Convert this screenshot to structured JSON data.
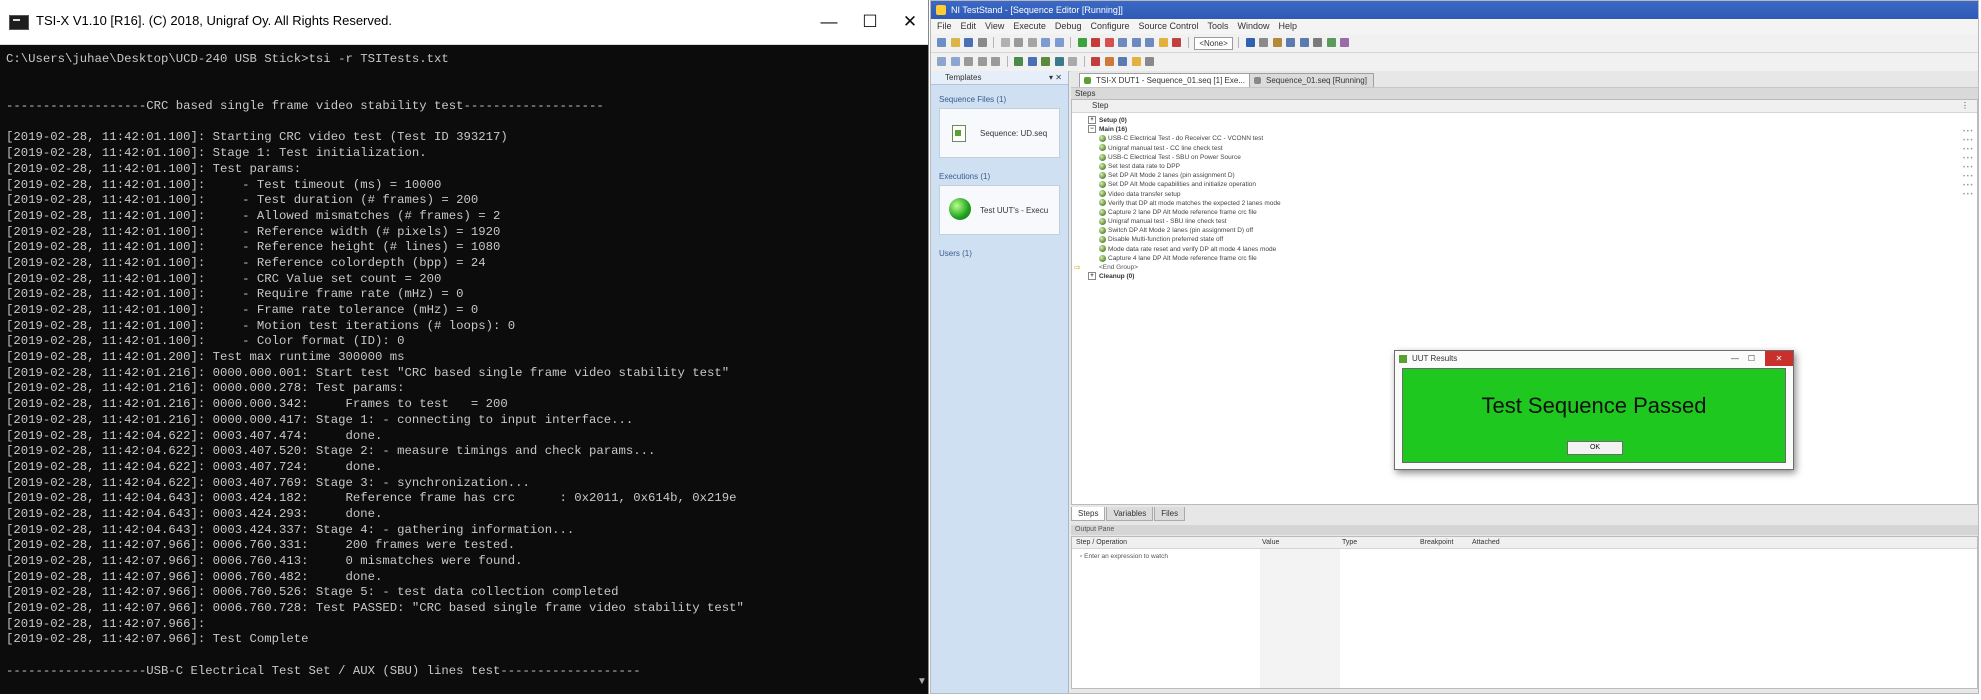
{
  "console": {
    "title": "TSI-X V1.10 [R16]. (C) 2018, Unigraf Oy. All Rights Reserved.",
    "controls": {
      "minimize": "—",
      "maximize": "☐",
      "close": "✕"
    },
    "lines": [
      "C:\\Users\\juhae\\Desktop\\UCD-240 USB Stick>tsi -r TSITests.txt",
      "",
      "",
      "-------------------CRC based single frame video stability test-------------------",
      "",
      "[2019-02-28, 11:42:01.100]: Starting CRC video test (Test ID 393217)",
      "[2019-02-28, 11:42:01.100]: Stage 1: Test initialization.",
      "[2019-02-28, 11:42:01.100]: Test params:",
      "[2019-02-28, 11:42:01.100]:     - Test timeout (ms) = 10000",
      "[2019-02-28, 11:42:01.100]:     - Test duration (# frames) = 200",
      "[2019-02-28, 11:42:01.100]:     - Allowed mismatches (# frames) = 2",
      "[2019-02-28, 11:42:01.100]:     - Reference width (# pixels) = 1920",
      "[2019-02-28, 11:42:01.100]:     - Reference height (# lines) = 1080",
      "[2019-02-28, 11:42:01.100]:     - Reference colordepth (bpp) = 24",
      "[2019-02-28, 11:42:01.100]:     - CRC Value set count = 200",
      "[2019-02-28, 11:42:01.100]:     - Require frame rate (mHz) = 0",
      "[2019-02-28, 11:42:01.100]:     - Frame rate tolerance (mHz) = 0",
      "[2019-02-28, 11:42:01.100]:     - Motion test iterations (# loops): 0",
      "[2019-02-28, 11:42:01.100]:     - Color format (ID): 0",
      "[2019-02-28, 11:42:01.200]: Test max runtime 300000 ms",
      "[2019-02-28, 11:42:01.216]: 0000.000.001: Start test \"CRC based single frame video stability test\"",
      "[2019-02-28, 11:42:01.216]: 0000.000.278: Test params:",
      "[2019-02-28, 11:42:01.216]: 0000.000.342:     Frames to test   = 200",
      "[2019-02-28, 11:42:01.216]: 0000.000.417: Stage 1: - connecting to input interface...",
      "[2019-02-28, 11:42:04.622]: 0003.407.474:     done.",
      "[2019-02-28, 11:42:04.622]: 0003.407.520: Stage 2: - measure timings and check params...",
      "[2019-02-28, 11:42:04.622]: 0003.407.724:     done.",
      "[2019-02-28, 11:42:04.622]: 0003.407.769: Stage 3: - synchronization...",
      "[2019-02-28, 11:42:04.643]: 0003.424.182:     Reference frame has crc      : 0x2011, 0x614b, 0x219e",
      "[2019-02-28, 11:42:04.643]: 0003.424.293:     done.",
      "[2019-02-28, 11:42:04.643]: 0003.424.337: Stage 4: - gathering information...",
      "[2019-02-28, 11:42:07.966]: 0006.760.331:     200 frames were tested.",
      "[2019-02-28, 11:42:07.966]: 0006.760.413:     0 mismatches were found.",
      "[2019-02-28, 11:42:07.966]: 0006.760.482:     done.",
      "[2019-02-28, 11:42:07.966]: 0006.760.526: Stage 5: - test data collection completed",
      "[2019-02-28, 11:42:07.966]: 0006.760.728: Test PASSED: \"CRC based single frame video stability test\"",
      "[2019-02-28, 11:42:07.966]:",
      "[2019-02-28, 11:42:07.966]: Test Complete",
      "",
      "-------------------USB-C Electrical Test Set / AUX (SBU) lines test-------------------"
    ]
  },
  "teststand": {
    "title": "NI TestStand - [Sequence Editor [Running]]",
    "menu": [
      "File",
      "Edit",
      "View",
      "Execute",
      "Debug",
      "Configure",
      "Source Control",
      "Tools",
      "Window",
      "Help"
    ],
    "model_combo": "<None>",
    "left_pane": {
      "header": "Templates",
      "groups": [
        {
          "title": "Sequence Files (1)",
          "item": "Sequence: UD.seq"
        },
        {
          "title": "Executions (1)",
          "item": "Test UUT's - Execu"
        },
        {
          "title": "Users (1)"
        }
      ]
    },
    "doc_tabs": [
      "TSI-X DUT1 - Sequence_01.seq [1] Exe...",
      "Sequence_01.seq [Running]"
    ],
    "steps_label": "Steps",
    "steps_col": "Step",
    "step_groups": {
      "setup": "Setup (0)",
      "main": "Main (16)",
      "cleanup": "Cleanup (0)"
    },
    "steps": [
      "USB-C Electrical Test - do Receiver CC - VCONN test",
      "Unigraf manual test - CC line check test",
      "USB-C Electrical Test - SBU on Power Source",
      "Set test data rate to DPP",
      "Set DP Alt Mode 2 lanes (pin assignment D)",
      "Set DP Alt Mode capabilities and initialize operation",
      "Video data transfer setup",
      "Verify that DP alt mode matches the expected 2 lanes mode",
      "Capture 2 lane DP Alt Mode reference frame crc file",
      "Unigraf manual test - SBU line check test",
      "Switch DP Alt Mode 2 lanes (pin assignment D) off",
      "Disable Multi-function preferred state off",
      "Mode data rate reset and verify DP alt mode 4 lanes mode",
      "Capture 4 lane DP Alt Mode reference frame crc file"
    ],
    "end_group": "<End Group>",
    "bottom_tabs": [
      "Steps",
      "Variables",
      "Files"
    ],
    "results_label": "Output Pane",
    "results_cols": [
      "Step / Operation",
      "Value",
      "Type",
      "Breakpoint",
      "Attached"
    ],
    "results_row": "Enter an expression to watch"
  },
  "dialog": {
    "title": "UUT Results",
    "message": "Test Sequence Passed",
    "ok_label": "OK",
    "bg_color": "#1ec81e"
  }
}
